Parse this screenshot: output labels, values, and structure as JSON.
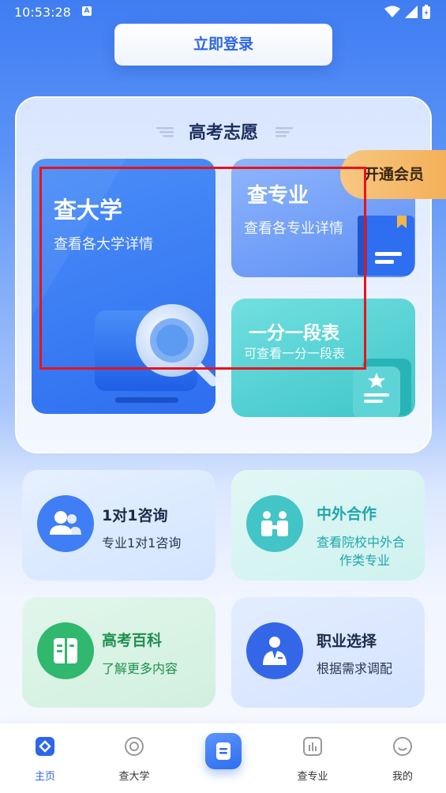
{
  "status": {
    "time": "10:53:28",
    "notif_badge": "A"
  },
  "login": {
    "label": "立即登录"
  },
  "main": {
    "title": "高考志愿",
    "tiles": {
      "university": {
        "title": "查大学",
        "subtitle": "查看各大学详情",
        "icon": "magnifier-monitor-icon"
      },
      "major": {
        "title": "查专业",
        "subtitle": "查看各专业详情",
        "icon": "book-icon"
      },
      "rank": {
        "title": "一分一段表",
        "subtitle": "可查看一分一段表",
        "icon": "star-document-icon"
      }
    },
    "vip": {
      "label": "开通会员"
    }
  },
  "features": {
    "consult": {
      "title": "1对1咨询",
      "subtitle": "专业1对1咨询",
      "icon": "users-icon",
      "color": "#3f7ef5"
    },
    "foreign": {
      "title": "中外合作",
      "subtitle_line1": "查看院校中外合",
      "subtitle_line2": "作类专业",
      "icon": "handshake-icon",
      "color": "#43c4c6"
    },
    "baike": {
      "title": "高考百科",
      "subtitle": "了解更多内容",
      "icon": "book-open-icon",
      "color": "#2fb86e"
    },
    "career": {
      "title": "职业选择",
      "subtitle": "根据需求调配",
      "icon": "person-suit-icon",
      "color": "#3467e8"
    }
  },
  "nav": {
    "items": [
      {
        "label": "主页",
        "icon": "home-diamond-icon",
        "active": true
      },
      {
        "label": "查大学",
        "icon": "circle-target-icon",
        "active": false
      },
      {
        "label": "",
        "icon": "document-list-icon",
        "active": false
      },
      {
        "label": "查专业",
        "icon": "bar-chart-icon",
        "active": false
      },
      {
        "label": "我的",
        "icon": "smile-icon",
        "active": false
      }
    ]
  },
  "colors": {
    "accent": "#2d66e8",
    "vip": "#f3b058",
    "highlight_box": "#e8131a"
  }
}
